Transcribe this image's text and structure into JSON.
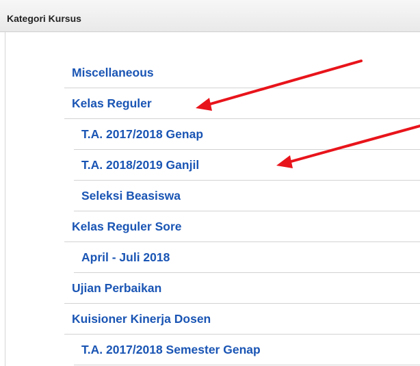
{
  "block": {
    "title": "Kategori Kursus"
  },
  "categories": [
    {
      "label": "Miscellaneous",
      "level": 1
    },
    {
      "label": "Kelas Reguler",
      "level": 1
    },
    {
      "label": "T.A. 2017/2018 Genap",
      "level": 2
    },
    {
      "label": "T.A. 2018/2019 Ganjil",
      "level": 2
    },
    {
      "label": "Seleksi Beasiswa",
      "level": 2
    },
    {
      "label": "Kelas Reguler Sore",
      "level": 1
    },
    {
      "label": "April - Juli 2018",
      "level": 2
    },
    {
      "label": "Ujian Perbaikan",
      "level": 1
    },
    {
      "label": "Kuisioner Kinerja Dosen",
      "level": 1
    },
    {
      "label": "T.A. 2017/2018 Semester Genap",
      "level": 2
    }
  ],
  "colors": {
    "link": "#1a55b4",
    "annotation_arrow": "#e8141b",
    "header_bg": "#eeeeee"
  },
  "annotations": [
    {
      "icon": "red-arrow",
      "points_to": "Kelas Reguler"
    },
    {
      "icon": "red-arrow",
      "points_to": "T.A. 2018/2019 Ganjil"
    }
  ]
}
